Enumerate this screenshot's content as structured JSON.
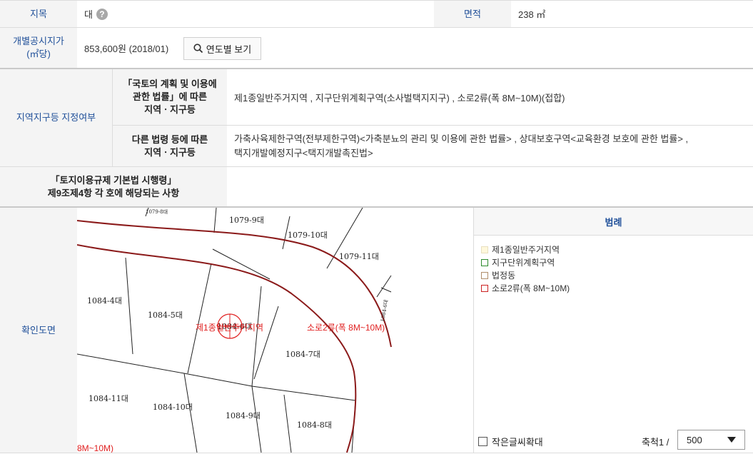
{
  "row1": {
    "jimok_label": "지목",
    "jimok_value": "대",
    "area_label": "면적",
    "area_value": "238 ㎡"
  },
  "row2": {
    "price_label_line1": "개별공시지가",
    "price_label_line2": "(㎡당)",
    "price_value": "853,600원 (2018/01)",
    "year_button": "연도별 보기"
  },
  "zone": {
    "label": "지역지구등 지정여부",
    "sub1_label_line1": "「국토의 계획 및 이용에",
    "sub1_label_line2": "관한 법률」에 따른",
    "sub1_label_line3": "지역ㆍ지구등",
    "sub1_value": "제1종일반주거지역 , 지구단위계획구역(소사벌택지지구) , 소로2류(폭 8M~10M)(접합)",
    "sub2_label_line1": "다른 법령 등에 따른",
    "sub2_label_line2": "지역ㆍ지구등",
    "sub2_value_line1": "가축사육제한구역(전부제한구역)<가축분뇨의 관리 및 이용에 관한 법률> , 상대보호구역<교육환경 보호에 관한 법률> ,",
    "sub2_value_line2": "택지개발예정지구<택지개발촉진법>"
  },
  "enforce": {
    "label_line1": "「토지이용규제 기본법 시행령」",
    "label_line2": "제9조제4항 각 호에 해당되는 사항",
    "value": ""
  },
  "map_section": {
    "label": "확인도면",
    "parcels": [
      "1079-9대",
      "1079-10대",
      "1079-11대",
      "1084-4대",
      "1084-5대",
      "1084-6대",
      "1084-7대",
      "1084-8대",
      "1084-9대",
      "1084-10대",
      "1084-11대"
    ],
    "overlay_zone": "제1종일반주거지역",
    "overlay_road": "소로2류(폭 8M~10M)",
    "overlay_road_partial": "8M~10M)",
    "partial_top_label": "1079-8대",
    "partial_right_label": "1084-6대"
  },
  "legend": {
    "title": "범례",
    "items": [
      {
        "label": "제1종일반주거지역",
        "color": "#fff8dc"
      },
      {
        "label": "지구단위계획구역",
        "color": "#2e8b2e"
      },
      {
        "label": "법정동",
        "color": "#b08d6a"
      },
      {
        "label": "소로2류(폭 8M~10M)",
        "color": "#cc2222"
      }
    ],
    "small_text_label": "작은글씨확대",
    "scale_label": "축척1 /",
    "scale_value": "500"
  },
  "colors": {
    "header_text": "#1f4f99",
    "road_line": "#8b1a1a",
    "overlay_red": "#e02020"
  }
}
